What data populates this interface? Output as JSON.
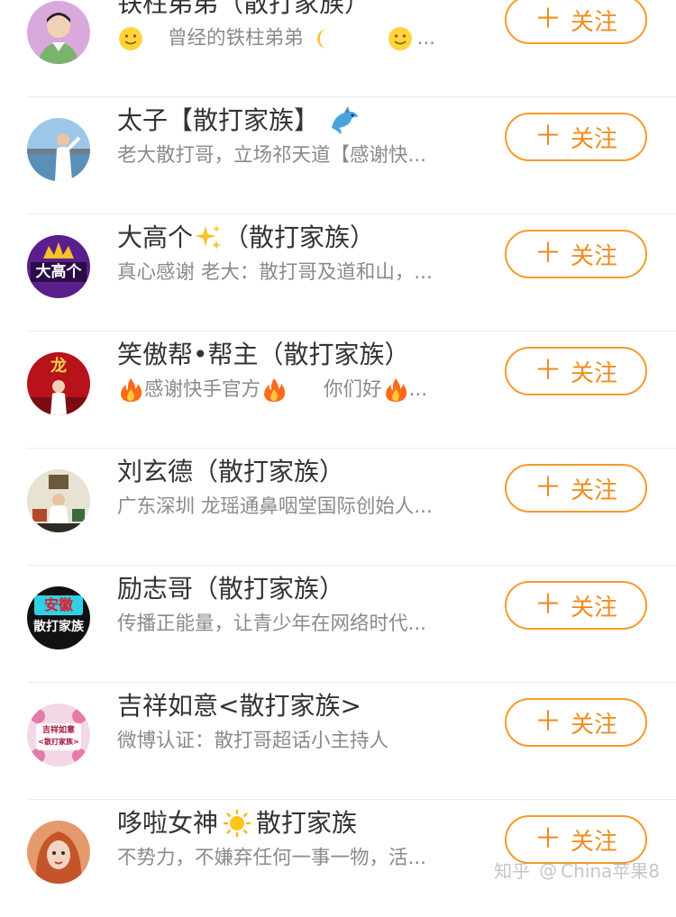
{
  "users": [
    {
      "name": "铁柱弟弟（散打家族）",
      "desc_parts": [
        "曾经的铁柱弟弟",
        "..."
      ],
      "follow_label": "关注",
      "avatar_icon": "man-avatar",
      "emoji": [
        "smile-emoji",
        "moon-emoji",
        "smile-emoji"
      ]
    },
    {
      "name": "太子【散打家族】",
      "desc": "老大散打哥，立场祁天道【感谢快...",
      "follow_label": "关注",
      "avatar_icon": "seaside-man-avatar",
      "emoji": [
        "dolphin-emoji"
      ]
    },
    {
      "name_a": "大高个",
      "name_b": "（散打家族）",
      "desc": "真心感谢 老大：散打哥及道和山，...",
      "follow_label": "关注",
      "avatar_text": "大高个",
      "avatar_icon": "crown-avatar",
      "emoji": [
        "sparkles-emoji"
      ]
    },
    {
      "name": "笑傲帮•帮主（散打家族）",
      "desc_parts": [
        "感谢快手官方",
        "你们好",
        "..."
      ],
      "follow_label": "关注",
      "avatar_text": "龙",
      "avatar_icon": "stage-avatar",
      "emoji": [
        "fire-emoji",
        "fire-emoji",
        "fire-emoji"
      ]
    },
    {
      "name": "刘玄德（散打家族）",
      "desc": "广东深圳 龙瑶通鼻咽堂国际创始人...",
      "follow_label": "关注",
      "avatar_icon": "office-avatar"
    },
    {
      "name": "励志哥（散打家族）",
      "desc": "传播正能量，让青少年在网络时代...",
      "follow_label": "关注",
      "avatar_text_top": "安徽",
      "avatar_text_bottom": "散打家族",
      "avatar_icon": "text-badge-avatar"
    },
    {
      "name": "吉祥如意<散打家族>",
      "desc": "微博认证：散打哥超话小主持人",
      "follow_label": "关注",
      "avatar_text_top": "吉祥如意",
      "avatar_text_bottom": "<散打家族>",
      "avatar_icon": "floral-avatar"
    },
    {
      "name_a": "哆啦女神",
      "name_b": "散打家族",
      "desc": "不势力，不嫌弃任何一事一物，活...",
      "follow_label": "关注",
      "avatar_icon": "woman-avatar",
      "emoji": [
        "sun-emoji"
      ]
    }
  ],
  "watermark": {
    "site": "知乎",
    "at": "@",
    "user": "China苹果8"
  },
  "colors": {
    "accent": "#f08c1e",
    "border": "#f59b2a",
    "name": "#333333",
    "desc": "#8a8a8a",
    "divider": "#ececec"
  }
}
